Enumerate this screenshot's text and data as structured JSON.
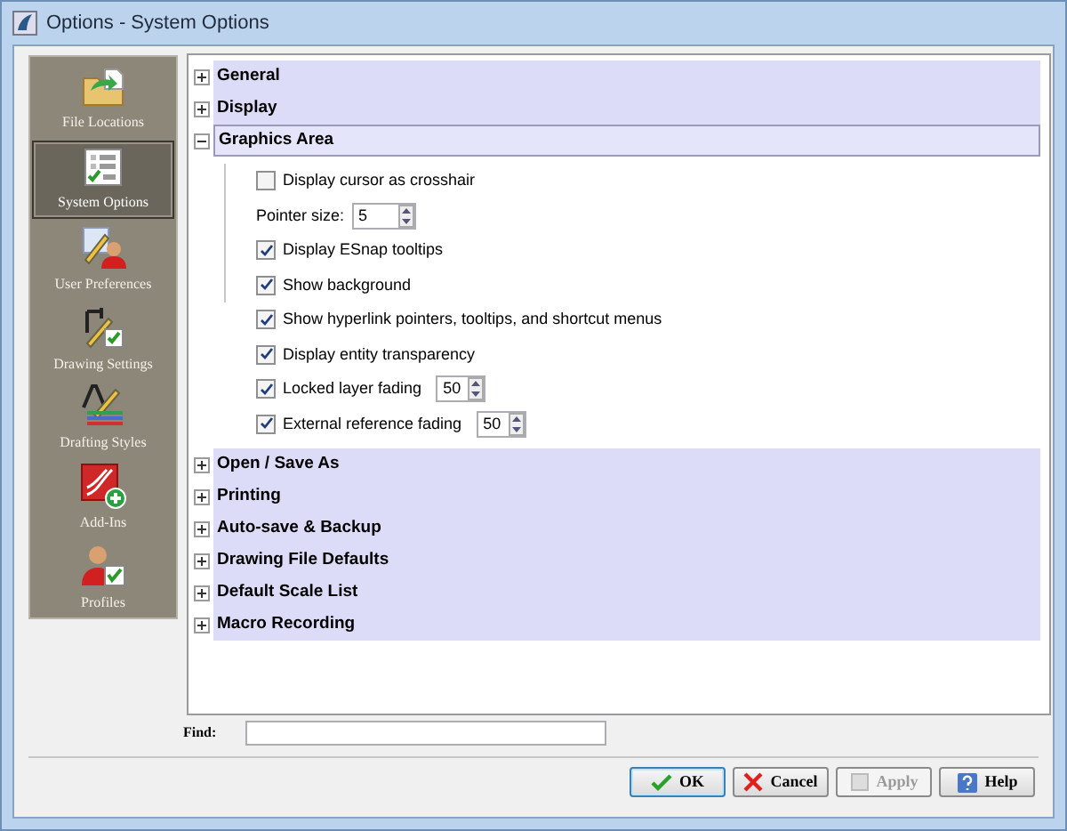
{
  "window": {
    "title": "Options - System Options"
  },
  "sidebar": {
    "items": [
      {
        "label": "File Locations",
        "selected": false
      },
      {
        "label": "System Options",
        "selected": true
      },
      {
        "label": "User Preferences",
        "selected": false
      },
      {
        "label": "Drawing Settings",
        "selected": false
      },
      {
        "label": "Drafting Styles",
        "selected": false
      },
      {
        "label": "Add-Ins",
        "selected": false
      },
      {
        "label": "Profiles",
        "selected": false
      }
    ]
  },
  "sections": [
    {
      "title": "General",
      "expanded": false
    },
    {
      "title": "Display",
      "expanded": false
    },
    {
      "title": "Graphics Area",
      "expanded": true,
      "groups": [
        {
          "bracketed": true,
          "items": [
            {
              "kind": "checkbox",
              "label": "Display cursor as crosshair",
              "checked": false
            },
            {
              "kind": "spin",
              "label": "Pointer size:",
              "value": "5"
            },
            {
              "kind": "checkbox",
              "label": "Display ESnap tooltips",
              "checked": true
            },
            {
              "kind": "checkbox",
              "label": "Show background",
              "checked": true
            }
          ]
        },
        {
          "bracketed": false,
          "items": [
            {
              "kind": "checkbox",
              "label": "Show hyperlink pointers, tooltips, and shortcut menus",
              "checked": true
            },
            {
              "kind": "checkbox",
              "label": "Display entity transparency",
              "checked": true
            },
            {
              "kind": "checkbox_spin",
              "label": "Locked layer fading",
              "checked": true,
              "value": "50"
            },
            {
              "kind": "checkbox_spin",
              "label": "External reference fading",
              "checked": true,
              "value": "50"
            }
          ]
        }
      ]
    },
    {
      "title": "Open / Save As",
      "expanded": false
    },
    {
      "title": "Printing",
      "expanded": false
    },
    {
      "title": "Auto-save & Backup",
      "expanded": false
    },
    {
      "title": "Drawing File Defaults",
      "expanded": false
    },
    {
      "title": "Default Scale List",
      "expanded": false
    },
    {
      "title": "Macro Recording",
      "expanded": false
    }
  ],
  "find": {
    "label": "Find:"
  },
  "buttons": [
    {
      "kind": "ok",
      "label": "OK",
      "disabled": false
    },
    {
      "kind": "cancel",
      "label": "Cancel",
      "disabled": false
    },
    {
      "kind": "apply",
      "label": "Apply",
      "disabled": true
    },
    {
      "kind": "help",
      "label": "Help",
      "disabled": false
    }
  ]
}
